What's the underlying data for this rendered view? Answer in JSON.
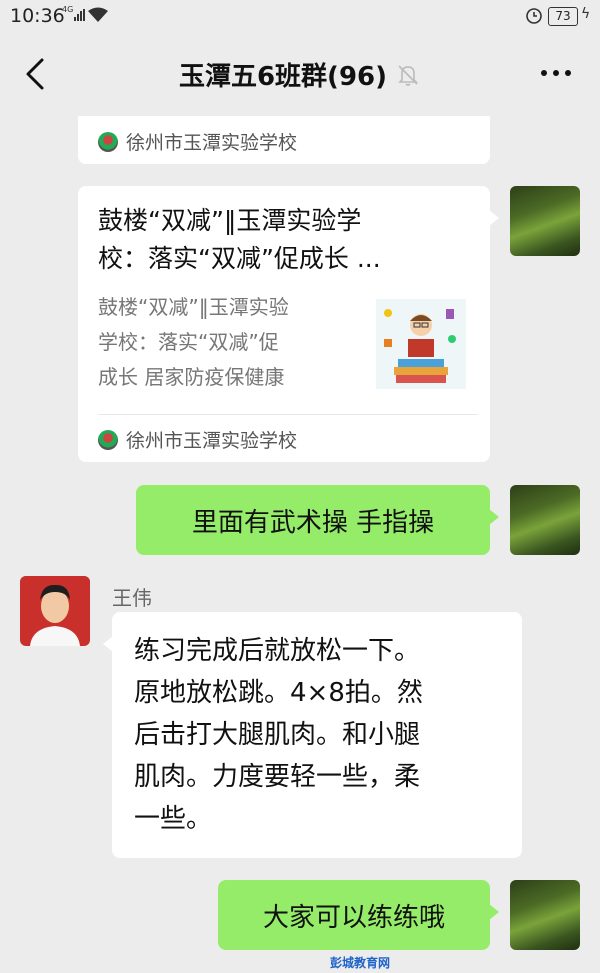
{
  "status_bar": {
    "time": "10:36",
    "network": "4G",
    "battery": "73"
  },
  "chat": {
    "title": "玉潭五6班群(96)"
  },
  "messages": {
    "top_card": {
      "source": "徐州市玉潭实验学校"
    },
    "article_card": {
      "title_line1": "鼓楼“双减”‖玉潭实验学",
      "title_line2": "校：落实“双减”促成长 ...",
      "desc_line1": "鼓楼“双减”‖玉潭实验",
      "desc_line2": "学校：落实“双减”促",
      "desc_line3": "成长 居家防疫保健康",
      "source": "徐州市玉潭实验学校"
    },
    "my_msg_1": "里面有武术操  手指操",
    "wang_wei": {
      "name": "王伟",
      "line1": "练习完成后就放松一下。",
      "line2": "原地放松跳。4×8拍。然",
      "line3": "后击打大腿肌肉。和小腿",
      "line4": "肌肉。力度要轻一些，柔",
      "line5": "一些。"
    },
    "my_msg_2": "大家可以练练哦"
  },
  "watermark": {
    "text": "彭城教育网"
  },
  "colors": {
    "green_bubble": "#95ec69",
    "background": "#ececec"
  }
}
